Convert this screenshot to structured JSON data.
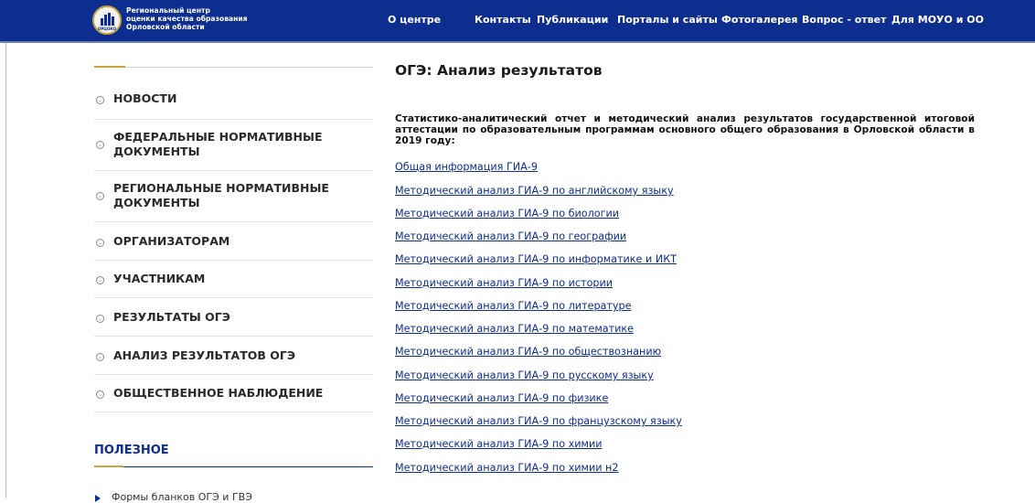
{
  "header": {
    "org_lines": [
      "Региональный центр",
      "оценки качества образования",
      "Орловской области"
    ],
    "logo_text": "ОРЦОКО",
    "nav": [
      "О центре",
      "Контакты",
      "Публикации",
      "Порталы и сайты",
      "Фотогалерея",
      "Вопрос - ответ",
      "Для МОУО и ОО"
    ]
  },
  "sidebar": {
    "items": [
      {
        "label": "НОВОСТИ",
        "icon": "circle-chevron-icon"
      },
      {
        "label": "ФЕДЕРАЛЬНЫЕ НОРМАТИВНЫЕ ДОКУМЕНТЫ",
        "icon": "circle-chevron-icon"
      },
      {
        "label": "РЕГИОНАЛЬНЫЕ НОРМАТИВНЫЕ ДОКУМЕНТЫ",
        "icon": "circle-chevron-icon"
      },
      {
        "label": "ОРГАНИЗАТОРАМ",
        "icon": "circle-chevron-icon"
      },
      {
        "label": "УЧАСТНИКАМ",
        "icon": "circle-chevron-icon"
      },
      {
        "label": "РЕЗУЛЬТАТЫ ОГЭ",
        "icon": "circle-chevron-icon"
      },
      {
        "label": "АНАЛИЗ РЕЗУЛЬТАТОВ ОГЭ",
        "icon": "circle-chevron-icon"
      },
      {
        "label": "ОБЩЕСТВЕННОЕ НАБЛЮДЕНИЕ",
        "icon": "circle-chevron-icon"
      }
    ],
    "useful_title": "ПОЛЕЗНОЕ",
    "useful_items": [
      "Формы бланков ОГЭ и ГВЭ"
    ]
  },
  "main": {
    "title": "ОГЭ: Анализ результатов",
    "intro": "Статистико-аналитический отчет и методический анализ результатов государственной итоговой аттестации по образовательным программам основного общего образования в Орловской области в 2019 году:",
    "links": [
      "Общая информация ГИА-9",
      "Методический анализ ГИА-9 по английскому языку",
      "Методический анализ ГИА-9 по биологии",
      "Методический анализ ГИА-9 по географии",
      "Методический анализ ГИА-9 по информатике и ИКТ",
      "Методический анализ ГИА-9 по истории",
      "Методический анализ ГИА-9 по литературе",
      "Методический анализ ГИА-9 по математике",
      "Методический анализ ГИА-9 по обществознанию",
      "Методический анализ ГИА-9 по русскому языку",
      "Методический анализ ГИА-9 по физике",
      "Методический анализ ГИА-9 по французскому языку",
      "Методический анализ ГИА-9 по химии",
      "Методический анализ ГИА-9 по химии н2"
    ]
  },
  "colors": {
    "brand": "#0d2d8f",
    "accent": "#c9a43a",
    "link": "#0d2d8f"
  }
}
